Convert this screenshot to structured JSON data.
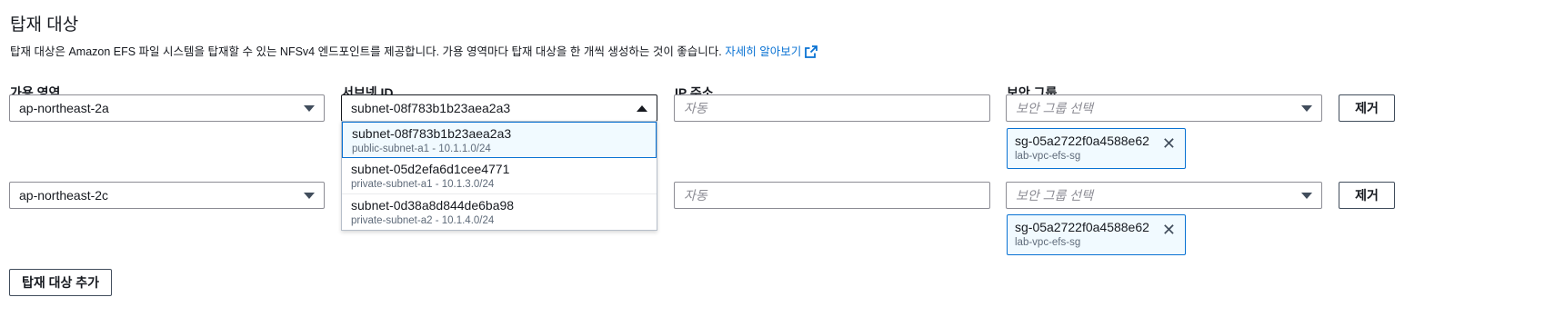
{
  "section": {
    "title": "탑재 대상",
    "description": "탑재 대상은 Amazon EFS 파일 시스템을 탑재할 수 있는 NFSv4 엔드포인트를 제공합니다. 가용 영역마다 탑재 대상을 한 개씩 생성하는 것이 좋습니다.",
    "learn_more": "자세히 알아보기"
  },
  "columns": {
    "az": "가용 영역",
    "subnet": "서브넷 ID",
    "ip": "IP 주소",
    "sg": "보안 그룹"
  },
  "rows": [
    {
      "az": "ap-northeast-2a",
      "subnet": "subnet-08f783b1b23aea2a3",
      "ip_placeholder": "자동",
      "sg_placeholder": "보안 그룹 선택",
      "remove_label": "제거",
      "token": {
        "id": "sg-05a2722f0a4588e62",
        "name": "lab-vpc-efs-sg"
      }
    },
    {
      "az": "ap-northeast-2c",
      "ip_placeholder": "자동",
      "sg_placeholder": "보안 그룹 선택",
      "remove_label": "제거",
      "token": {
        "id": "sg-05a2722f0a4588e62",
        "name": "lab-vpc-efs-sg"
      }
    }
  ],
  "subnet_options": [
    {
      "id": "subnet-08f783b1b23aea2a3",
      "detail": "public-subnet-a1 - 10.1.1.0/24"
    },
    {
      "id": "subnet-05d2efa6d1cee4771",
      "detail": "private-subnet-a1 - 10.1.3.0/24"
    },
    {
      "id": "subnet-0d38a8d844de6ba98",
      "detail": "private-subnet-a2 - 10.1.4.0/24"
    }
  ],
  "add_button": "탑재 대상 추가",
  "colors": {
    "accent": "#0972d3",
    "text": "#16191f",
    "border": "#8c8c94"
  }
}
